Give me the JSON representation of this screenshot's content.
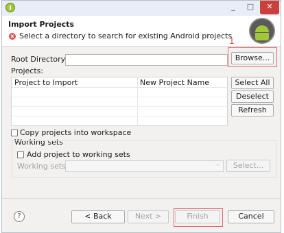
{
  "window": {
    "close_glyph": "✕",
    "min_glyph": "_",
    "max_glyph": "□"
  },
  "banner": {
    "title": "Import Projects",
    "message": "Select a directory to search for existing Android projects",
    "error_icon_glyph": "x"
  },
  "annotation": {
    "label": "1"
  },
  "root": {
    "label": "Root Directory:",
    "value": "",
    "browse_label": "Browse..."
  },
  "projects": {
    "label": "Projects:",
    "columns": [
      "Project to Import",
      "New Project Name"
    ],
    "rows": [],
    "select_all_label": "Select All",
    "deselect_all_label": "Deselect All",
    "refresh_label": "Refresh"
  },
  "options": {
    "copy_label": "Copy projects into workspace",
    "copy_checked": false
  },
  "working_sets": {
    "group_label": "Working sets",
    "add_label": "Add project to working sets",
    "add_checked": false,
    "sets_label": "Working sets:",
    "sets_value": "",
    "select_label": "Select..."
  },
  "footer": {
    "help_glyph": "?",
    "back_label": "< Back",
    "next_label": "Next >",
    "finish_label": "Finish",
    "cancel_label": "Cancel"
  },
  "colors": {
    "annotation": "#e0453a",
    "close_button": "#c9413a",
    "android_green": "#a4c639"
  },
  "icons": [
    "android-app-icon",
    "error-icon",
    "android-logo-icon",
    "help-icon",
    "chevron-down-icon"
  ]
}
